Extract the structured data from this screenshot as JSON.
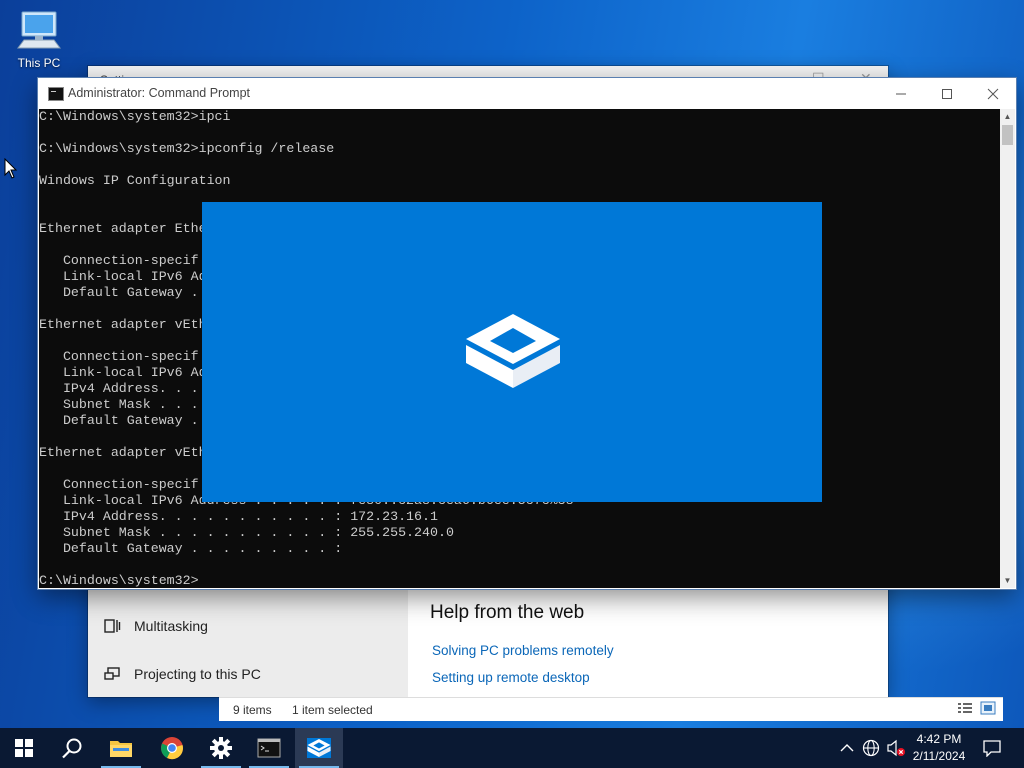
{
  "desktop": {
    "icons": [
      {
        "label": "This PC",
        "icon": "this-pc-icon"
      }
    ]
  },
  "settings_window": {
    "title": "Settings",
    "sidebar_items": [
      {
        "label": "Multitasking",
        "icon": "multitasking-icon"
      },
      {
        "label": "Projecting to this PC",
        "icon": "projecting-icon"
      }
    ],
    "help": {
      "title": "Help from the web",
      "links": [
        "Solving PC problems remotely",
        "Setting up remote desktop"
      ]
    }
  },
  "explorer_status": {
    "items_count": "9 items",
    "selection": "1 item selected"
  },
  "cmd_window": {
    "title": "Administrator: Command Prompt",
    "lines": [
      "C:\\Windows\\system32>ipci",
      "",
      "C:\\Windows\\system32>ipconfig /release",
      "",
      "Windows IP Configuration",
      "",
      "",
      "Ethernet adapter Ethe",
      "",
      "   Connection-specif",
      "   Link-local IPv6 Ad",
      "   Default Gateway .",
      "",
      "Ethernet adapter vEth",
      "",
      "   Connection-specif",
      "   Link-local IPv6 Ad",
      "   IPv4 Address. . .",
      "   Subnet Mask . . .",
      "   Default Gateway .",
      "",
      "Ethernet adapter vEth",
      "",
      "   Connection-specif",
      "   Link-local IPv6 Address . . . . . : fe80::c2a8:cea6:b6ee:5c7c%38",
      "   IPv4 Address. . . . . . . . . . . : 172.23.16.1",
      "   Subnet Mask . . . . . . . . . . . : 255.255.240.0",
      "   Default Gateway . . . . . . . . . :",
      "",
      "C:\\Windows\\system32>"
    ]
  },
  "sandbox_splash": {
    "icon": "windows-sandbox-logo-icon",
    "background": "#0078d7"
  },
  "taskbar": {
    "items": [
      {
        "name": "start",
        "icon": "windows-start-icon"
      },
      {
        "name": "search",
        "icon": "search-icon"
      },
      {
        "name": "file-explorer",
        "icon": "folder-icon"
      },
      {
        "name": "chrome",
        "icon": "chrome-icon"
      },
      {
        "name": "settings",
        "icon": "gear-icon"
      },
      {
        "name": "command-prompt",
        "icon": "cmd-icon"
      },
      {
        "name": "windows-sandbox",
        "icon": "sandbox-icon"
      }
    ],
    "tray": {
      "time": "4:42 PM",
      "date": "2/11/2024"
    }
  },
  "colors": {
    "accent": "#0078d7",
    "taskbar": "#0a1933",
    "console_bg": "#0c0c0c",
    "console_text": "#cccccc",
    "link": "#0b67b8"
  }
}
